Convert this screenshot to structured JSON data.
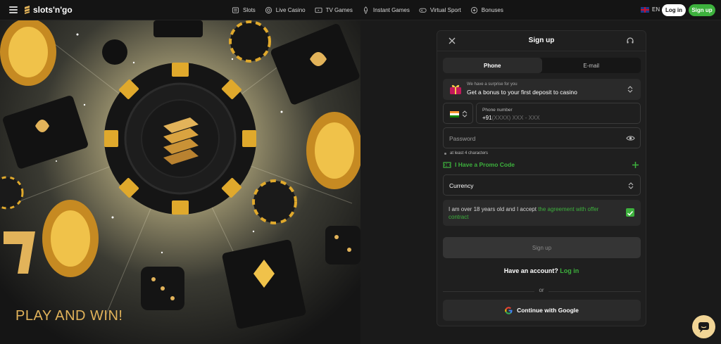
{
  "header": {
    "logo_text": "slots'n'go",
    "nav": [
      {
        "label": "Slots",
        "icon": "slot-machine-icon"
      },
      {
        "label": "Live Casino",
        "icon": "chip-icon"
      },
      {
        "label": "TV Games",
        "icon": "tv-icon"
      },
      {
        "label": "Instant Games",
        "icon": "rocket-icon"
      },
      {
        "label": "Virtual Sport",
        "icon": "gamepad-icon"
      },
      {
        "label": "Bonuses",
        "icon": "gift-icon"
      }
    ],
    "language": "EN",
    "login_label": "Log in",
    "signup_label": "Sign up"
  },
  "hero": {
    "title": "PLAY AND WIN!"
  },
  "modal": {
    "title": "Sign up",
    "tabs": [
      {
        "label": "Phone",
        "active": true
      },
      {
        "label": "E-mail",
        "active": false
      }
    ],
    "bonus": {
      "subtitle": "We have a surprise for you",
      "text": "Get a bonus to your first deposit to casino"
    },
    "phone": {
      "label": "Phone number",
      "prefix": "+91",
      "placeholder": "(XXXX) XXX - XXX"
    },
    "password": {
      "placeholder": "Password",
      "hint": "at least 4 characters"
    },
    "promo_label": "I Have a Promo Code",
    "currency_label": "Currency",
    "agreement": {
      "text": "I am over 18 years old and I accept ",
      "link": "the agreement with offer contract",
      "checked": true
    },
    "submit_label": "Sign up",
    "have_account": "Have an account?",
    "login_link": "Log in",
    "or": "or",
    "google_label": "Continue with Google"
  },
  "colors": {
    "accent_green": "#3db13d",
    "gold": "#e2b35a",
    "panel": "#1f1f1f"
  }
}
